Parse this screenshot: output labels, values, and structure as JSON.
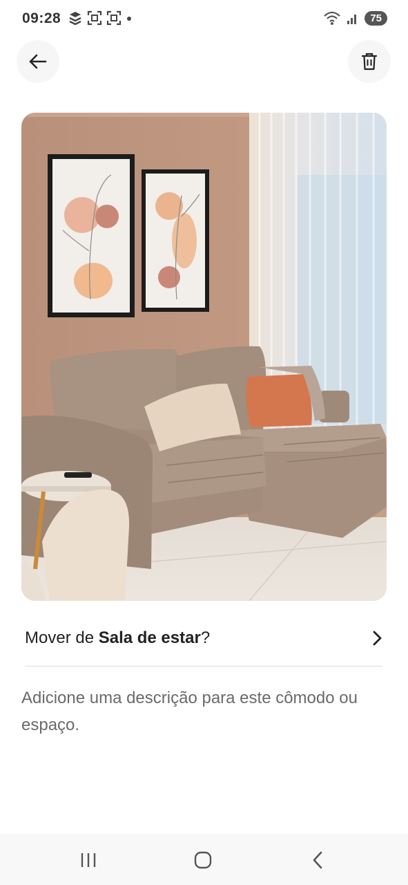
{
  "status_bar": {
    "time": "09:28",
    "left_icons": [
      "app-notification-icon",
      "screenshot-icon",
      "screenshot-icon",
      "dot-icon"
    ],
    "right_icons": [
      "wifi-icon",
      "signal-icon"
    ],
    "battery": "75"
  },
  "header": {
    "back_icon": "arrow-left-icon",
    "delete_icon": "trash-icon"
  },
  "photo": {
    "subject": "living-room-photo"
  },
  "move": {
    "prefix": "Mover de ",
    "room": "Sala de estar",
    "suffix": "?",
    "icon": "chevron-right-icon"
  },
  "description": {
    "placeholder": "Adicione uma descrição para este cômodo ou espaço."
  },
  "nav": {
    "icons": [
      "recent-apps-icon",
      "home-icon",
      "back-icon"
    ]
  }
}
